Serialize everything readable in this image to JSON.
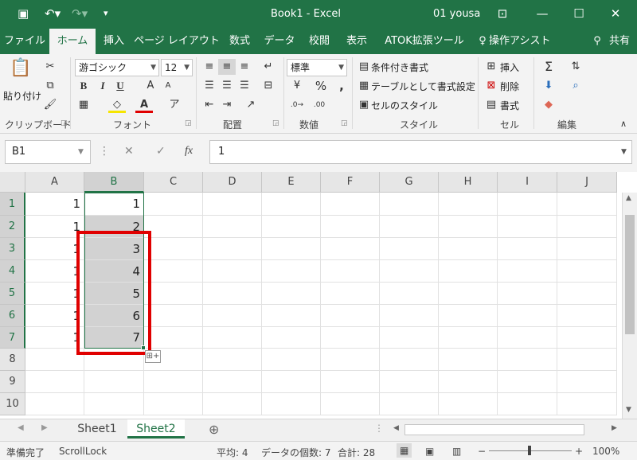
{
  "titlebar": {
    "title": "Book1  -  Excel",
    "user": "01 yousa",
    "save_icon": "save-icon",
    "undo_icon": "undo-icon",
    "redo_icon": "redo-icon"
  },
  "tabs": [
    {
      "label": "ファイル"
    },
    {
      "label": "ホーム"
    },
    {
      "label": "挿入"
    },
    {
      "label": "ページ レイアウト"
    },
    {
      "label": "数式"
    },
    {
      "label": "データ"
    },
    {
      "label": "校閲"
    },
    {
      "label": "表示"
    },
    {
      "label": "ATOK拡張ツール"
    },
    {
      "label": "操作アシスト"
    },
    {
      "label": "共有"
    }
  ],
  "ribbon": {
    "clipboard": {
      "paste": "貼り付け",
      "label": "クリップボード"
    },
    "font": {
      "name": "游ゴシック",
      "size": "12",
      "label": "フォント",
      "bold": "B",
      "italic": "I",
      "underline": "U",
      "grow": "A",
      "shrink": "A"
    },
    "alignment": {
      "label": "配置"
    },
    "number": {
      "format": "標準",
      "percent": "%",
      "comma": ",",
      "label": "数値"
    },
    "styles": {
      "cond": "条件付き書式",
      "table": "テーブルとして書式設定",
      "cell": "セルのスタイル",
      "label": "スタイル"
    },
    "cells": {
      "insert": "挿入",
      "delete": "削除",
      "format": "書式",
      "label": "セル"
    },
    "editing": {
      "label": "編集"
    }
  },
  "formula_bar": {
    "name_box": "B1",
    "value": "1",
    "fx": "fx"
  },
  "grid": {
    "columns": [
      "A",
      "B",
      "C",
      "D",
      "E",
      "F",
      "G",
      "H",
      "I",
      "J"
    ],
    "rows": [
      "1",
      "2",
      "3",
      "4",
      "5",
      "6",
      "7",
      "8",
      "9",
      "10"
    ],
    "col_a": [
      "1",
      "1",
      "1",
      "1",
      "1",
      "1",
      "1"
    ],
    "col_b": [
      "1",
      "2",
      "3",
      "4",
      "5",
      "6",
      "7"
    ]
  },
  "sheets": [
    {
      "label": "Sheet1"
    },
    {
      "label": "Sheet2"
    }
  ],
  "status": {
    "ready": "準備完了",
    "scroll_lock": "ScrollLock",
    "average": "平均: 4",
    "count": "データの個数: 7",
    "sum": "合計: 28",
    "zoom": "100%"
  }
}
